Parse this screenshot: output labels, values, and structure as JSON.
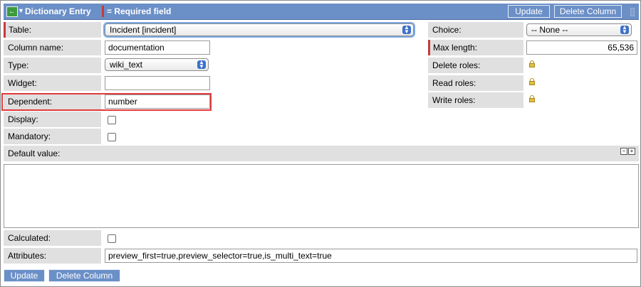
{
  "header": {
    "title": "Dictionary Entry",
    "required_note": "= Required field",
    "update_label": "Update",
    "delete_label": "Delete Column"
  },
  "fields": {
    "table": {
      "label": "Table:",
      "value": "Incident [incident]"
    },
    "column_name": {
      "label": "Column name:",
      "value": "documentation"
    },
    "type": {
      "label": "Type:",
      "value": "wiki_text"
    },
    "widget": {
      "label": "Widget:",
      "value": ""
    },
    "dependent": {
      "label": "Dependent:",
      "value": "number"
    },
    "display": {
      "label": "Display:"
    },
    "mandatory": {
      "label": "Mandatory:"
    },
    "default_value": {
      "label": "Default value:",
      "value": ""
    },
    "calculated": {
      "label": "Calculated:"
    },
    "attributes": {
      "label": "Attributes:",
      "value": "preview_first=true,preview_selector=true,is_multi_text=true"
    },
    "choice": {
      "label": "Choice:",
      "value": "-- None --"
    },
    "max_length": {
      "label": "Max length:",
      "value": "65,536"
    },
    "delete_roles": {
      "label": "Delete roles:"
    },
    "read_roles": {
      "label": "Read roles:"
    },
    "write_roles": {
      "label": "Write roles:"
    }
  },
  "footer": {
    "update_label": "Update",
    "delete_label": "Delete Column"
  },
  "colors": {
    "header_blue": "#6b8fc7",
    "required_red": "#c43b3b",
    "label_gray": "#e0e0e0",
    "highlight_red": "#e23a3a"
  }
}
